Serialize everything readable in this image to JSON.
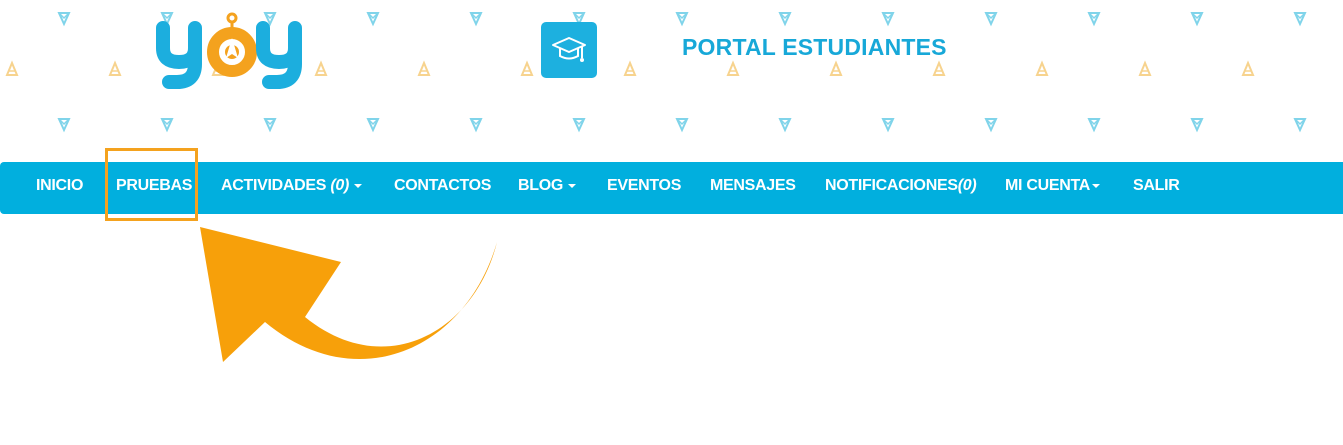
{
  "header": {
    "logo_text": "yoy",
    "portal_title": "PORTAL ESTUDIANTES",
    "icon": "graduation-cap-icon",
    "pattern_colors": [
      "#80d4ea",
      "#f7d38e"
    ]
  },
  "nav": {
    "background": "#01afde",
    "items": [
      {
        "label": "INICIO"
      },
      {
        "label": "PRUEBAS"
      },
      {
        "label": "ACTIVIDADES ",
        "count": "(0)",
        "has_dropdown": true
      },
      {
        "label": "CONTACTOS"
      },
      {
        "label": "BLOG",
        "has_dropdown": true
      },
      {
        "label": "EVENTOS"
      },
      {
        "label": "MENSAJES"
      },
      {
        "label": "NOTIFICACIONES",
        "count": "(0)"
      },
      {
        "label": "MI CUENTA",
        "has_dropdown": true
      },
      {
        "label": "SALIR"
      }
    ]
  },
  "annotation": {
    "highlighted_item": "PRUEBAS",
    "color": "#f4a21e"
  }
}
